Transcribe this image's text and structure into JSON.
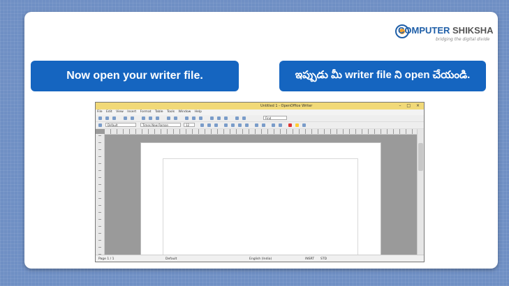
{
  "logo": {
    "part1": "COMPUTER",
    "part2": "SHIKSHA",
    "tagline": "bridging the digital divide"
  },
  "instructions": {
    "english": "Now open your writer file.",
    "telugu": "ఇప్పుడు మీ writer file ని open చేయండి."
  },
  "writer": {
    "window_title": "Untitled 1 - OpenOffice Writer",
    "menus": [
      "File",
      "Edit",
      "View",
      "Insert",
      "Format",
      "Table",
      "Tools",
      "Window",
      "Help"
    ],
    "style_value": "Default",
    "font_value": "Times New Roman",
    "size_value": "12",
    "find_value": "Find",
    "status": {
      "page": "Page 1 / 1",
      "style": "Default",
      "language": "English (India)",
      "mode": "INSRT",
      "selection": "STD"
    }
  },
  "colors": {
    "bubble": "#1565c0",
    "titlebar": "#f1d978",
    "background": "#6f8fc4"
  }
}
